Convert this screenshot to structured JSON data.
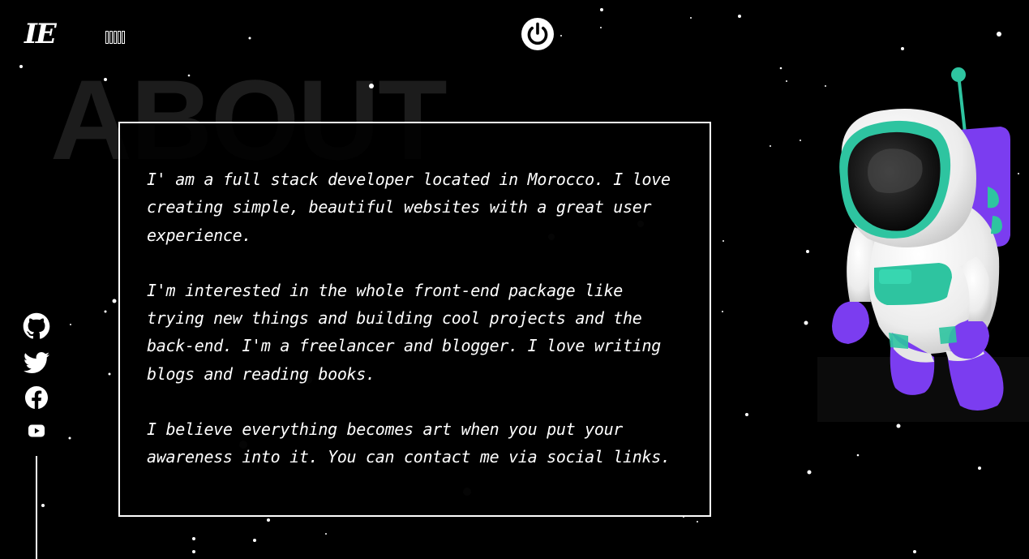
{
  "brand": {
    "logo_text": "IE"
  },
  "language_switch": {
    "glyphs": [
      "",
      "",
      "",
      "",
      ""
    ]
  },
  "header": {
    "power_icon": "power-icon"
  },
  "about": {
    "background_title": "ABOUT",
    "paragraphs": [
      "I' am a full stack developer located in Morocco. I love creating simple, beautiful websites with a great user experience.",
      "I'm interested in the whole front-end package like trying new things and building cool projects and the back-end. I'm a freelancer and blogger. I love writing blogs and reading books.",
      "I believe everything becomes art when you put your awareness into it. You can contact me via social links."
    ]
  },
  "social_links": [
    {
      "name": "github",
      "icon": "github-icon"
    },
    {
      "name": "twitter",
      "icon": "twitter-icon"
    },
    {
      "name": "facebook",
      "icon": "facebook-icon"
    },
    {
      "name": "youtube",
      "icon": "youtube-icon"
    }
  ],
  "illustration": {
    "icon": "astronaut-illustration"
  },
  "colors": {
    "background": "#000000",
    "text": "#ffffff",
    "astronaut_suit": "#f2f2f2",
    "astronaut_accent": "#2ec4a0",
    "astronaut_purple": "#7b3df0"
  }
}
